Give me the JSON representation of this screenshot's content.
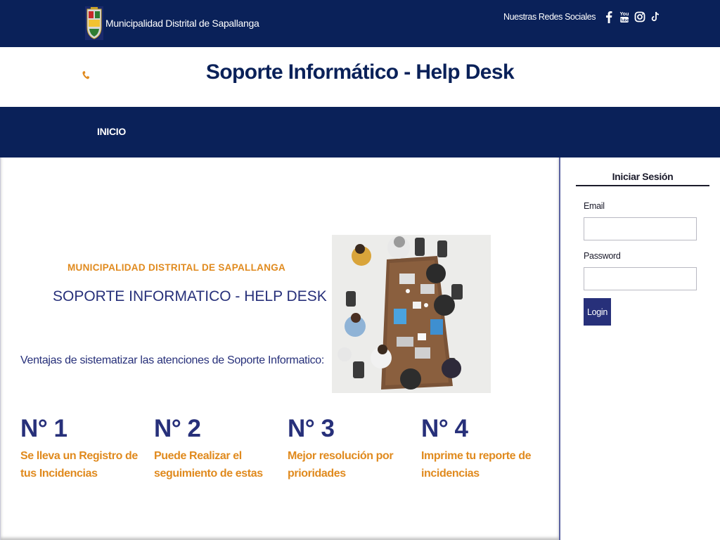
{
  "header": {
    "municipality_name": "Municipalidad Distrital de Sapallanga",
    "social_label": "Nuestras Redes Sociales",
    "social_icons": [
      "facebook-icon",
      "youtube-icon",
      "instagram-icon",
      "tiktok-icon"
    ]
  },
  "title_bar": {
    "title": "Soporte Informático - Help Desk",
    "contact_icon": "phone-icon"
  },
  "nav": {
    "items": [
      {
        "label": "INICIO"
      }
    ]
  },
  "main": {
    "municipality_heading": "MUNICIPALIDAD DISTRITAL DE SAPALLANGA",
    "subtitle": "SOPORTE INFORMATICO - HELP DESK",
    "advantages_intro": "Ventajas de sistematizar las atenciones de Soporte Informatico:",
    "features": [
      {
        "number": "N° 1",
        "text": "Se lleva un Registro de tus Incidencias"
      },
      {
        "number": "N° 2",
        "text": "Puede Realizar el seguimiento de estas"
      },
      {
        "number": "N° 3",
        "text": "Mejor resolución por prioridades"
      },
      {
        "number": "N° 4",
        "text": "Imprime tu reporte de incidencias"
      }
    ]
  },
  "login": {
    "title": "Iniciar Sesión",
    "email_label": "Email",
    "email_value": "",
    "password_label": "Password",
    "password_value": "",
    "button_label": "Login"
  },
  "colors": {
    "navy": "#0a2159",
    "accent_orange": "#e08a1e",
    "text_indigo": "#27307a"
  }
}
